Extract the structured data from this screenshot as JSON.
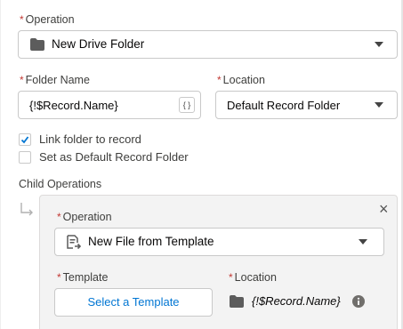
{
  "operation": {
    "required": "*",
    "label": "Operation",
    "value": "New Drive Folder"
  },
  "folder_name": {
    "required": "*",
    "label": "Folder Name",
    "value": "{!$Record.Name}",
    "merge_button": "{ }"
  },
  "location": {
    "required": "*",
    "label": "Location",
    "value": "Default Record Folder"
  },
  "checkboxes": {
    "link_folder": {
      "label": "Link folder to record",
      "checked": true
    },
    "default_folder": {
      "label": "Set as Default Record Folder",
      "checked": false
    }
  },
  "child_operations": {
    "label": "Child Operations",
    "close": "×",
    "operation": {
      "required": "*",
      "label": "Operation",
      "value": "New File from Template"
    },
    "template": {
      "required": "*",
      "label": "Template",
      "button_label": "Select a Template"
    },
    "location": {
      "required": "*",
      "label": "Location",
      "value": "{!$Record.Name}"
    }
  },
  "colors": {
    "required": "#c23934",
    "brand": "#0176d3",
    "border": "#c9c9c9",
    "panel_bg": "#f3f3f3"
  }
}
